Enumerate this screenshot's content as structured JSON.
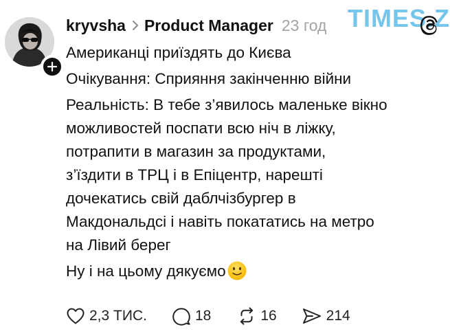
{
  "header": {
    "username": "kryvsha",
    "topic": "Product Manager",
    "time": "23 год"
  },
  "watermark": "TIMES.ZT",
  "post": {
    "lines": [
      "Американці приїздять до Києва",
      "Очікування: Сприяння закінченню війни",
      "Реальність: В тебе з’явилось маленьке вікно",
      "можливостей поспати всю ніч в ліжку,",
      "потрапити в магазин за продуктами,",
      "з’їздити в ТРЦ і в Епіцентр, нарешті",
      "дочекатись свій даблчізбургер в",
      "Макдональдсі і навіть покататись на метро",
      "на Лівий берег",
      "Ну і на цьому дякуємо"
    ],
    "emoji": "slightly-smiling-face"
  },
  "actions": {
    "likes": "2,3 ТИС.",
    "replies": "18",
    "reposts": "16",
    "shares": "214"
  },
  "icons": {
    "avatar": "avatar-photo",
    "follow": "plus-icon",
    "chevron": "chevron-right-icon",
    "logo": "threads-logo-icon",
    "like": "heart-icon",
    "reply": "comment-icon",
    "repost": "repost-icon",
    "share": "send-icon"
  }
}
